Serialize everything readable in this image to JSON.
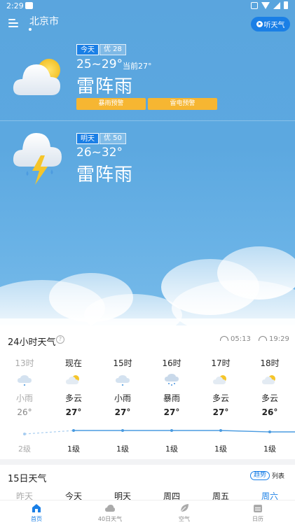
{
  "status_bar": {
    "time": "2:29"
  },
  "header": {
    "city": "北京市",
    "listen_label": "听天气"
  },
  "today": {
    "day_label": "今天",
    "aqi_label": "优 28",
    "temp_range": "25~29°",
    "current_temp": "当前27°",
    "condition": "雷阵雨",
    "warnings": [
      "暴雨预警",
      "雷电预警"
    ]
  },
  "tomorrow": {
    "day_label": "明天",
    "aqi_label": "优 50",
    "temp_range": "26~32°",
    "condition": "雷阵雨"
  },
  "hourly": {
    "title": "24小时天气",
    "sunrise": "05:13",
    "sunset": "19:29",
    "items": [
      {
        "time": "13时",
        "icon": "light-rain-icon",
        "desc": "小雨",
        "temp": "26°",
        "wind": "2级",
        "past": true
      },
      {
        "time": "现在",
        "icon": "partly-cloudy-icon",
        "desc": "多云",
        "temp": "27°",
        "wind": "1级",
        "past": false
      },
      {
        "time": "15时",
        "icon": "light-rain-icon",
        "desc": "小雨",
        "temp": "27°",
        "wind": "1级",
        "past": false
      },
      {
        "time": "16时",
        "icon": "heavy-rain-icon",
        "desc": "暴雨",
        "temp": "27°",
        "wind": "1级",
        "past": false
      },
      {
        "time": "17时",
        "icon": "partly-cloudy-icon",
        "desc": "多云",
        "temp": "27°",
        "wind": "1级",
        "past": false
      },
      {
        "time": "18时",
        "icon": "partly-cloudy-icon",
        "desc": "多云",
        "temp": "26°",
        "wind": "1级",
        "past": false
      }
    ]
  },
  "daily": {
    "title": "15日天气",
    "toggle_trend": "趋势",
    "toggle_list": "列表",
    "days": [
      "昨天",
      "今天",
      "明天",
      "周四",
      "周五",
      "周六"
    ]
  },
  "nav": {
    "items": [
      {
        "label": "首页",
        "icon": "home-icon",
        "active": true
      },
      {
        "label": "40日天气",
        "icon": "cloud-icon",
        "active": false
      },
      {
        "label": "空气",
        "icon": "leaf-icon",
        "active": false
      },
      {
        "label": "日历",
        "icon": "calendar-icon",
        "active": false
      }
    ]
  },
  "colors": {
    "accent": "#1a7fe6",
    "warning": "#f6b632",
    "sky": "#5ca8e0"
  }
}
